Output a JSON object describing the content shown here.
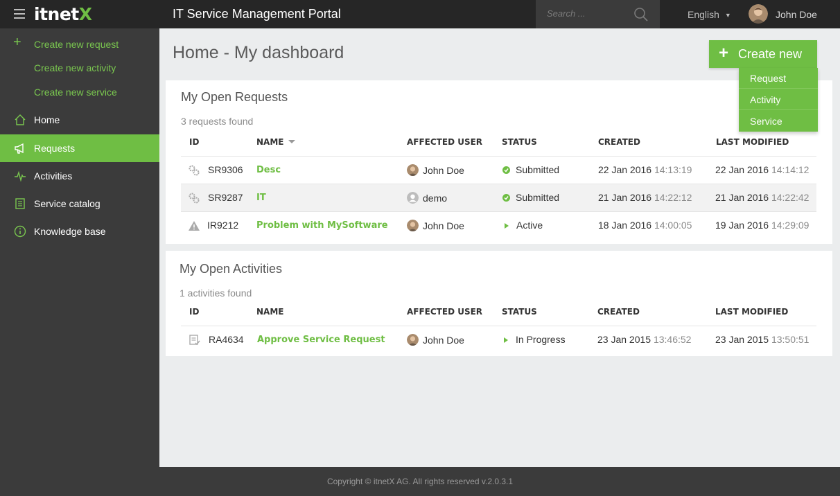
{
  "topbar": {
    "logo_main": "itnet",
    "logo_accent": "X",
    "title": "IT Service Management Portal",
    "search_placeholder": "Search ...",
    "language": "English",
    "user_name": "John Doe"
  },
  "sidebar": {
    "create_items": [
      {
        "label": "Create new request"
      },
      {
        "label": "Create new activity"
      },
      {
        "label": "Create new service"
      }
    ],
    "nav_items": [
      {
        "label": "Home",
        "icon": "home-icon",
        "active": false
      },
      {
        "label": "Requests",
        "icon": "megaphone-icon",
        "active": true
      },
      {
        "label": "Activities",
        "icon": "pulse-icon",
        "active": false
      },
      {
        "label": "Service catalog",
        "icon": "book-icon",
        "active": false
      },
      {
        "label": "Knowledge base",
        "icon": "info-icon",
        "active": false
      }
    ]
  },
  "main": {
    "page_title": "Home - My dashboard",
    "create_button": "Create new",
    "create_menu": [
      "Request",
      "Activity",
      "Service"
    ]
  },
  "requests": {
    "title": "My Open Requests",
    "found": "3 requests found",
    "columns": [
      "ID",
      "NAME",
      "AFFECTED USER",
      "STATUS",
      "CREATED",
      "LAST MODIFIED"
    ],
    "rows": [
      {
        "icon": "gears-icon",
        "id": "SR9306",
        "name": "Desc",
        "user": "John Doe",
        "user_avatar": "photo",
        "status": "Submitted",
        "status_icon": "check",
        "created_date": "22 Jan 2016",
        "created_time": "14:13:19",
        "modified_date": "22 Jan 2016",
        "modified_time": "14:14:12"
      },
      {
        "icon": "gears-icon",
        "id": "SR9287",
        "name": "IT",
        "user": "demo",
        "user_avatar": "generic",
        "status": "Submitted",
        "status_icon": "check",
        "created_date": "21 Jan 2016",
        "created_time": "14:22:12",
        "modified_date": "21 Jan 2016",
        "modified_time": "14:22:42"
      },
      {
        "icon": "warning-icon",
        "id": "IR9212",
        "name": "Problem with MySoftware",
        "user": "John Doe",
        "user_avatar": "photo",
        "status": "Active",
        "status_icon": "play",
        "created_date": "18 Jan 2016",
        "created_time": "14:00:05",
        "modified_date": "19 Jan 2016",
        "modified_time": "14:29:09"
      }
    ]
  },
  "activities": {
    "title": "My Open Activities",
    "found": "1 activities found",
    "columns": [
      "ID",
      "NAME",
      "AFFECTED USER",
      "STATUS",
      "CREATED",
      "LAST MODIFIED"
    ],
    "rows": [
      {
        "icon": "approval-icon",
        "id": "RA4634",
        "name": "Approve Service Request",
        "user": "John Doe",
        "user_avatar": "photo",
        "status": "In Progress",
        "status_icon": "play",
        "created_date": "23 Jan 2015",
        "created_time": "13:46:52",
        "modified_date": "23 Jan 2015",
        "modified_time": "13:50:51"
      }
    ]
  },
  "footer": {
    "text": "Copyright © itnetX AG. All rights reserved v.2.0.3.1"
  },
  "colors": {
    "accent": "#6fbe44",
    "topbar": "#262626",
    "sidebar": "#3b3b3b"
  }
}
